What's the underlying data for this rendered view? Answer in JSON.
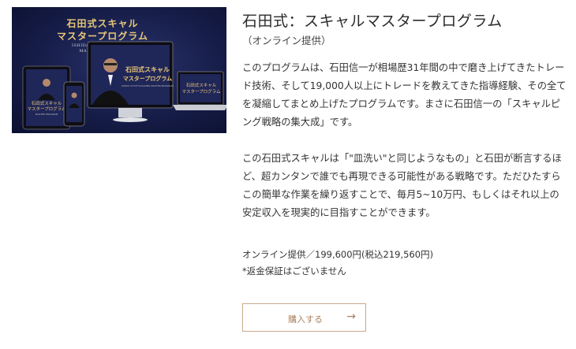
{
  "product": {
    "image": {
      "title_line1": "石田式スキャル",
      "title_line2": "マスタープログラム",
      "subtitle_line1": "ISHIDA STYLE SCALPING",
      "subtitle_line2": "MASTER PROGRAM",
      "monitor_title_line1": "石田式スキャル",
      "monitor_title_line2": "マスタープログラム",
      "monitor_subtitle": "ISHIDA STYLE SCALPING MASTER PROGRAM",
      "laptop_title_line1": "石田式スキャル",
      "laptop_title_line2": "マスタープログラム",
      "tablet_title_line1": "石田式スキャル",
      "tablet_title_line2": "マスタープログラム",
      "tablet_subtitle": "MASTER PROGRAM",
      "colors": {
        "background": "#161d48",
        "gold": "#e9c878"
      }
    },
    "title": "石田式：スキャルマスタープログラム",
    "subtitle": "（オンライン提供）",
    "description": [
      "このプログラムは、石田信一が相場歴31年間の中で磨き上げてきたトレード技術、そして19,000人以上にトレードを教えてきた指導経験、その全てを凝縮してまとめ上げたプログラムです。まさに石田信一の「スキャルピング戦略の集大成」です。",
      "この石田式スキャルは「\"皿洗い\"と同じようなもの」と石田が断言するほど、超カンタンで誰でも再現できる可能性がある戦略です。ただひたすらこの簡単な作業を繰り返すことで、毎月5~10万円、もしくはそれ以上の安定収入を現実的に目指すことができます。"
    ],
    "price": "オンライン提供／199,600円(税込219,560円)",
    "note": "*返金保証はございません",
    "buy_button": {
      "label": "購入する",
      "arrow": "→",
      "border_color": "#c9a98b",
      "text_color": "#a9825f"
    }
  }
}
